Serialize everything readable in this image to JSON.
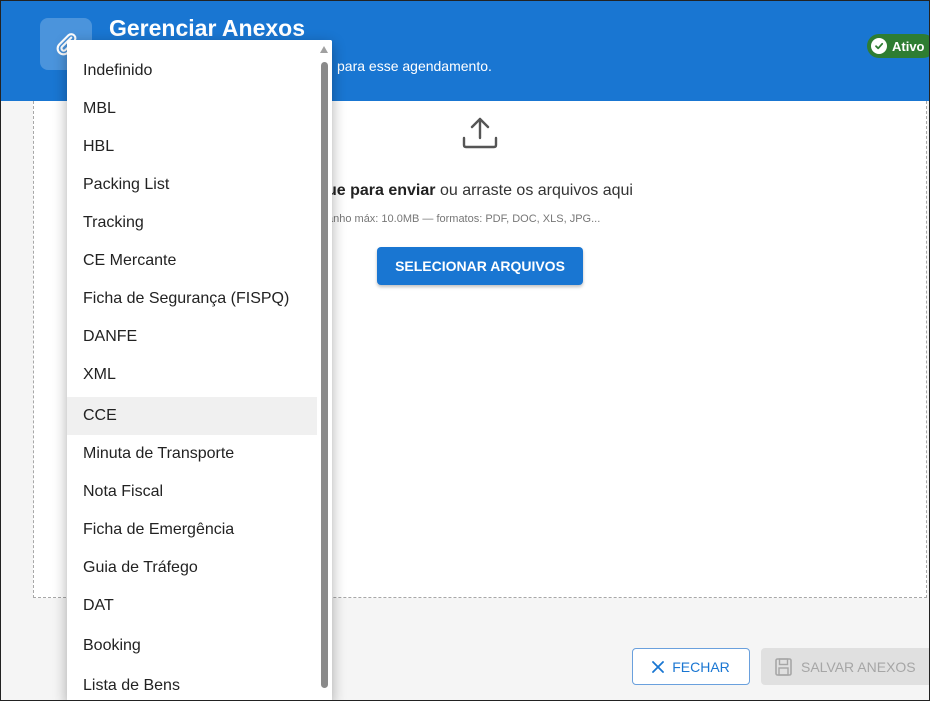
{
  "header": {
    "title": "Gerenciar Anexos",
    "subtitle": "para esse agendamento.",
    "icon": "paperclip-icon",
    "status": "Ativo",
    "color": "#1976d2"
  },
  "dropzone": {
    "icon": "upload-icon",
    "text_bold": "ue para enviar",
    "text_rest": " ou arraste os arquivos aqui",
    "hint": "anho máx: 10.0MB — formatos: PDF, DOC, XLS, JPG...",
    "select_button": "SELECIONAR ARQUIVOS"
  },
  "footer": {
    "close_label": "FECHAR",
    "save_label": "SALVAR ANEXOS"
  },
  "dropdown": {
    "items": [
      "Indefinido",
      "MBL",
      "HBL",
      "Packing List",
      "Tracking",
      "CE Mercante",
      "Ficha de Segurança (FISPQ)",
      "DANFE",
      "XML",
      "CCE",
      "Minuta de Transporte",
      "Nota Fiscal",
      "Ficha de Emergência",
      "Guia de Tráfego",
      "DAT",
      "Booking",
      "Lista de Bens"
    ],
    "highlighted": "CCE"
  }
}
